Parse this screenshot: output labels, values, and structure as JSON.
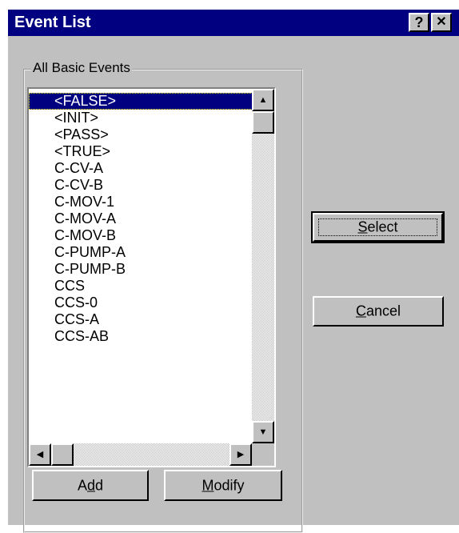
{
  "dialog": {
    "title": "Event List",
    "help_button": "?",
    "close_button": "✕"
  },
  "group": {
    "label": "All Basic Events"
  },
  "list": {
    "items": [
      "<FALSE>",
      "<INIT>",
      "<PASS>",
      "<TRUE>",
      "C-CV-A",
      "C-CV-B",
      "C-MOV-1",
      "C-MOV-A",
      "C-MOV-B",
      "C-PUMP-A",
      "C-PUMP-B",
      "CCS",
      "CCS-0",
      "CCS-A",
      "CCS-AB"
    ],
    "selected_index": 0
  },
  "scrollbars": {
    "up_icon": "▲",
    "down_icon": "▼",
    "left_icon": "◀",
    "right_icon": "▶"
  },
  "buttons": {
    "select_pre": "",
    "select_mnemonic": "S",
    "select_post": "elect",
    "cancel_pre": "",
    "cancel_mnemonic": "C",
    "cancel_post": "ancel",
    "add_pre": "A",
    "add_mnemonic": "d",
    "add_post": "d",
    "modify_pre": "",
    "modify_mnemonic": "M",
    "modify_post": "odify"
  },
  "colors": {
    "title_bar": "#000080",
    "face": "#c0c0c0",
    "selection": "#000080"
  }
}
